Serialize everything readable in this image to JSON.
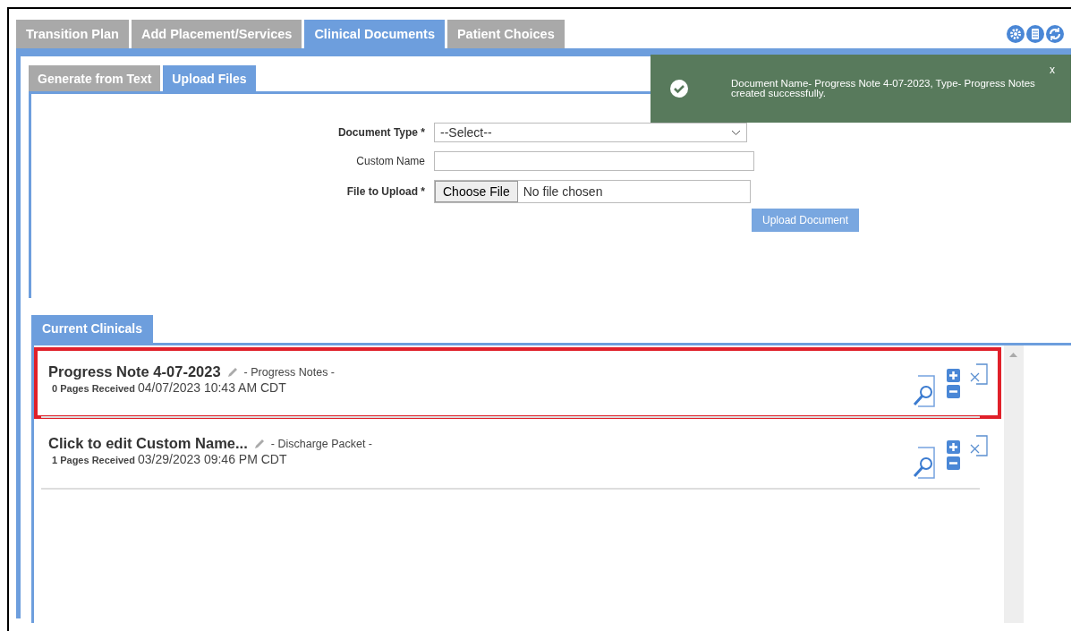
{
  "tabs": [
    {
      "label": "Transition Plan",
      "selected": false
    },
    {
      "label": "Add Placement/Services",
      "selected": false
    },
    {
      "label": "Clinical Documents",
      "selected": true
    },
    {
      "label": "Patient Choices",
      "selected": false
    }
  ],
  "subtabs": [
    {
      "label": "Generate from Text",
      "selected": false
    },
    {
      "label": "Upload Files",
      "selected": true
    }
  ],
  "notification": {
    "message": "Document Name- Progress Note 4-07-2023, Type- Progress Notes created successfully.",
    "close": "x"
  },
  "form": {
    "document_type": {
      "label": "Document Type *",
      "value": "--Select--"
    },
    "custom_name": {
      "label": "Custom Name"
    },
    "file": {
      "label": "File to Upload *",
      "button": "Choose File",
      "status": "No file chosen"
    },
    "submit": "Upload Document"
  },
  "clinicals": {
    "tab": "Current Clinicals",
    "items": [
      {
        "name": "Progress Note 4-07-2023",
        "type": "- Progress Notes -",
        "pages": "0 Pages Received",
        "date": "04/07/2023 10:43 AM CDT",
        "highlighted": true
      },
      {
        "name": "Click to edit Custom Name...",
        "type": "- Discharge Packet -",
        "pages": "1 Pages Received",
        "date": "03/29/2023 09:46 PM CDT",
        "highlighted": false
      }
    ]
  }
}
